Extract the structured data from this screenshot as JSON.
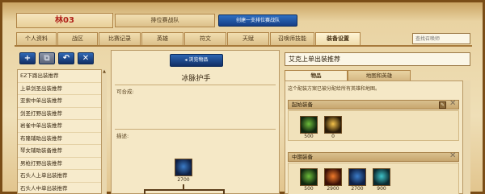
{
  "header": {
    "player_name": "林03",
    "queue_label": "排位赛战队",
    "create_team_button": "创建一支排位赛战队"
  },
  "tabs": [
    {
      "label": "个人资料"
    },
    {
      "label": "战区"
    },
    {
      "label": "比赛记录"
    },
    {
      "label": "英雄"
    },
    {
      "label": "符文"
    },
    {
      "label": "天赋"
    },
    {
      "label": "召唤师技能"
    },
    {
      "label": "装备设置",
      "active": true
    }
  ],
  "search": {
    "placeholder": "查找召唤师"
  },
  "toolbar": {
    "add": "+",
    "copy": "⧉",
    "undo": "↶",
    "delete": "✕"
  },
  "build_list": [
    "EZ下路出装推荐",
    "上单剑圣出装推荐",
    "亚索中单出装推荐",
    "剑圣打野出装推荐",
    "岩雀中单出装推荐",
    "布隆辅助出装推荐",
    "琴女辅助装备推荐",
    "男枪打野出装推荐",
    "石头人上单出装推荐",
    "石头人中单出装推荐"
  ],
  "middle": {
    "browse_button": "浏览物品",
    "item_name": "冰脉护手",
    "composed_label": "可合成:",
    "description_label": "描述:",
    "item_price": "2700"
  },
  "right": {
    "build_title": "艾克上单出装推荐",
    "tabs": [
      {
        "label": "物品",
        "active": true
      },
      {
        "label": "地图和英雄"
      }
    ],
    "hint": "这个配装方案已被分配给所有英雄和地图。",
    "groups": [
      {
        "title": "起始装备",
        "items": [
          {
            "icon": "green-orb-icon",
            "price": "500"
          },
          {
            "icon": "yellow-potion-icon",
            "price": "0"
          }
        ]
      },
      {
        "title": "中期装备",
        "items": [
          {
            "icon": "green-orb-icon",
            "price": "500"
          },
          {
            "icon": "fire-sword-icon",
            "price": "2900"
          },
          {
            "icon": "flame-item-icon",
            "price": "2700"
          },
          {
            "icon": "ice-gauntlet-icon",
            "price": "900"
          }
        ]
      }
    ]
  }
}
